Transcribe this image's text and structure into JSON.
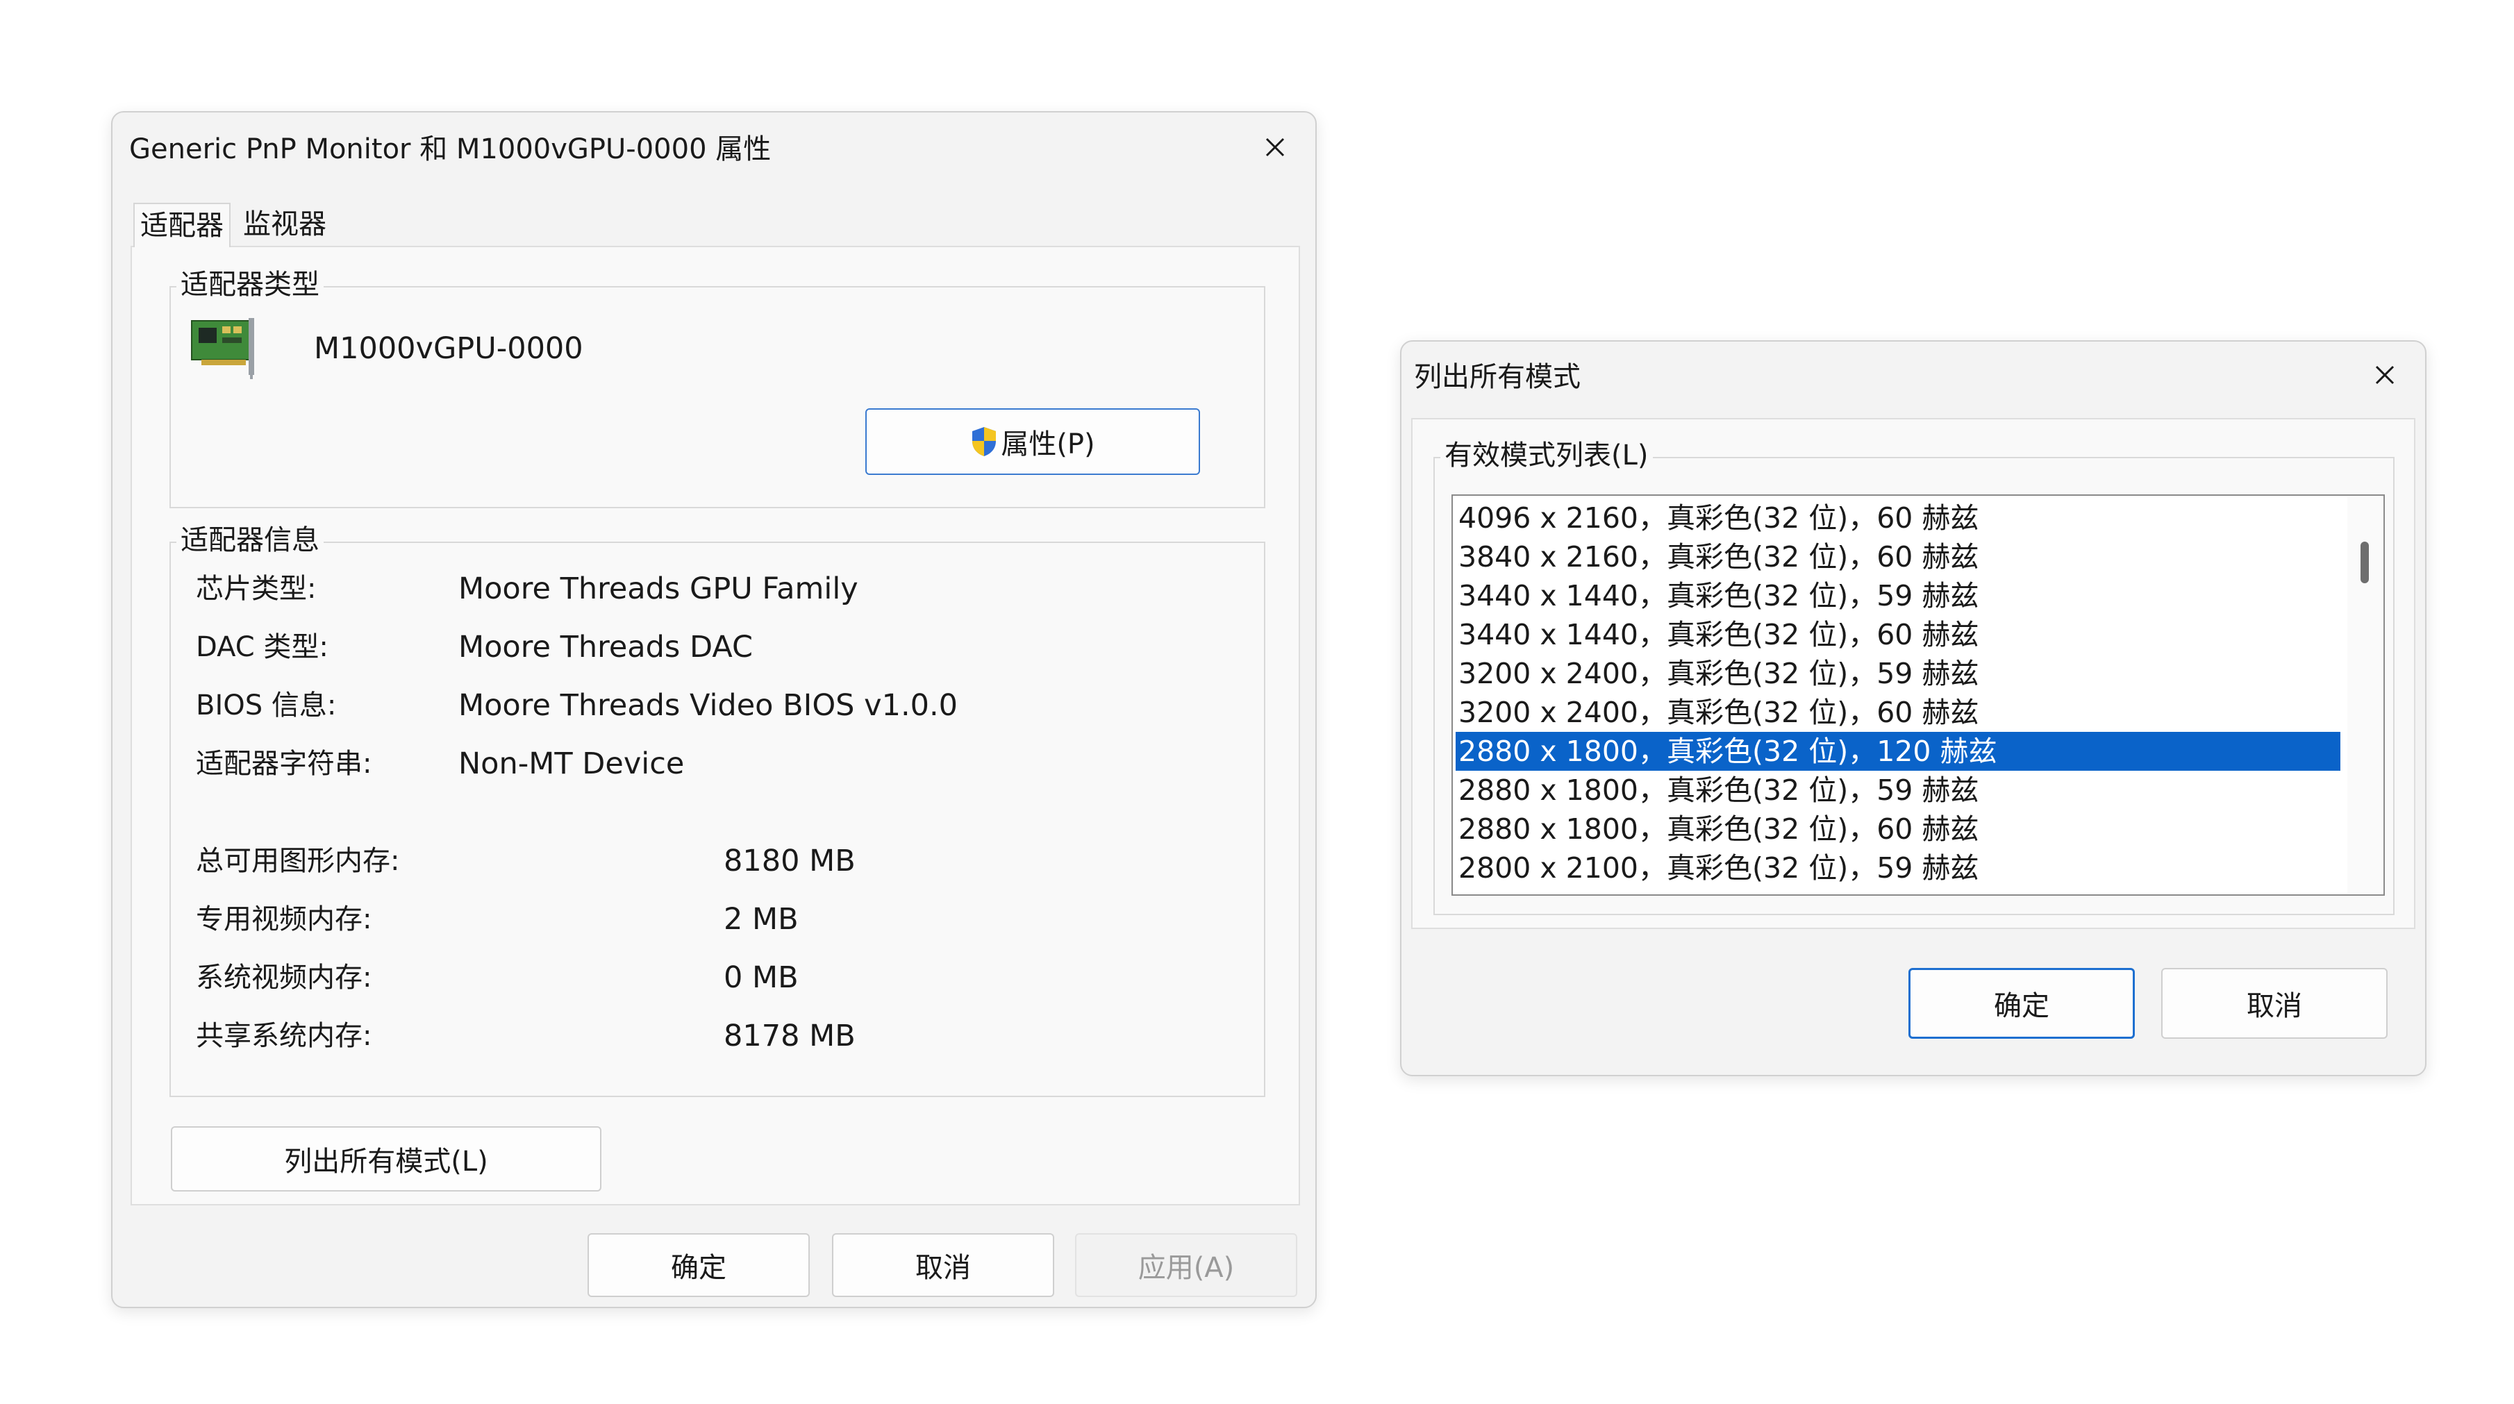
{
  "props_dialog": {
    "title": "Generic PnP Monitor 和 M1000vGPU-0000 属性",
    "tabs": [
      "适配器",
      "监视器"
    ],
    "adapter_type": {
      "legend": "适配器类型",
      "name": "M1000vGPU-0000",
      "properties_button": "属性(P)"
    },
    "adapter_info": {
      "legend": "适配器信息",
      "chip_label": "芯片类型:",
      "chip_value": "Moore Threads GPU Family",
      "dac_label": "DAC 类型:",
      "dac_value": "Moore Threads DAC",
      "bios_label": "BIOS 信息:",
      "bios_value": "Moore Threads Video BIOS v1.0.0",
      "string_label": "适配器字符串:",
      "string_value": "Non-MT Device",
      "total_label": "总可用图形内存:",
      "total_value": "8180 MB",
      "dedicated_label": "专用视频内存:",
      "dedicated_value": "2 MB",
      "system_label": "系统视频内存:",
      "system_value": "0 MB",
      "shared_label": "共享系统内存:",
      "shared_value": "8178 MB"
    },
    "list_modes_button": "列出所有模式(L)",
    "ok": "确定",
    "cancel": "取消",
    "apply": "应用(A)"
  },
  "modes_dialog": {
    "title": "列出所有模式",
    "legend": "有效模式列表(L)",
    "modes": [
      "4096 x 2160，真彩色(32 位)，60 赫兹",
      "3840 x 2160，真彩色(32 位)，60 赫兹",
      "3440 x 1440，真彩色(32 位)，59 赫兹",
      "3440 x 1440，真彩色(32 位)，60 赫兹",
      "3200 x 2400，真彩色(32 位)，59 赫兹",
      "3200 x 2400，真彩色(32 位)，60 赫兹",
      "2880 x 1800，真彩色(32 位)，120 赫兹",
      "2880 x 1800，真彩色(32 位)，59 赫兹",
      "2880 x 1800，真彩色(32 位)，60 赫兹",
      "2800 x 2100，真彩色(32 位)，59 赫兹"
    ],
    "selected_mode": "2880 x 1800，真彩色(32 位)，120 赫兹",
    "ok": "确定",
    "cancel": "取消"
  },
  "colors": {
    "accent": "#0a63c9",
    "button_focus_border": "#1d6fd0"
  }
}
